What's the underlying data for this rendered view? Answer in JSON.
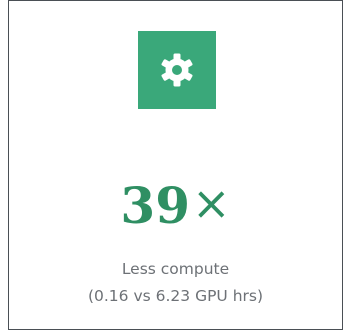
{
  "icon": "gear-icon",
  "colors": {
    "accent": "#3aa87a",
    "value_text": "#2f8f63",
    "description_text": "#6d7176",
    "border": "#4a4f55"
  },
  "metric": {
    "value": "39",
    "suffix": "×"
  },
  "description": {
    "line1": "Less compute",
    "line2": "(0.16 vs 6.23 GPU hrs)"
  }
}
